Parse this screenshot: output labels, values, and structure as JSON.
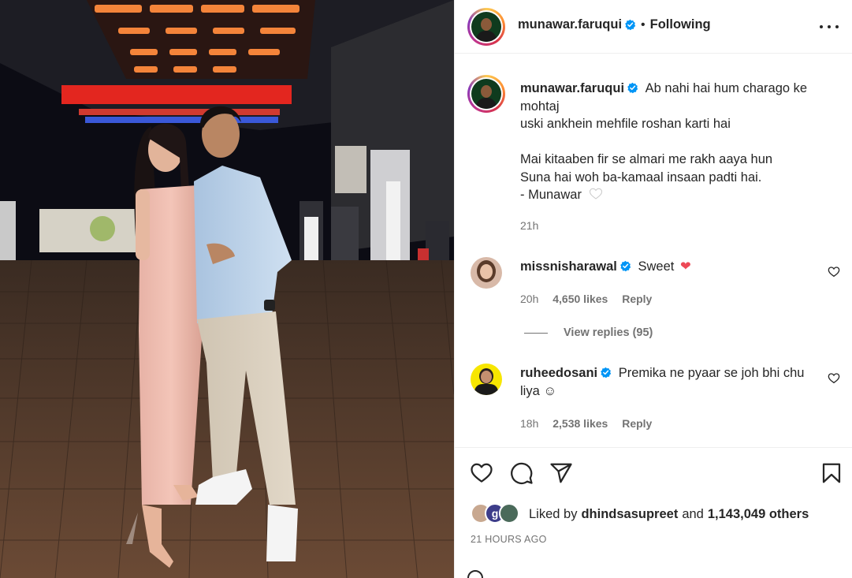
{
  "post": {
    "author": "munawar.faruqui",
    "follow_separator": "•",
    "follow_status": "Following",
    "more_icon": "more-horizontal-icon"
  },
  "caption": {
    "username": "munawar.faruqui",
    "lines": [
      "Ab nahi hai hum charago ke",
      "mohtaj",
      "uski ankhein mehfile roshan karti hai",
      "",
      "Mai kitaaben fir se almari me rakh aaya hun",
      "Suna hai woh ba-kamaal insaan padti hai.",
      "- Munawar"
    ],
    "time": "21h"
  },
  "comments": [
    {
      "username": "missnisharawal",
      "text": "Sweet",
      "emoji": "❤",
      "time": "20h",
      "likes": "4,650 likes",
      "reply": "Reply",
      "replies_link": "View replies (95)"
    },
    {
      "username": "ruheedosani",
      "text": "Premika ne pyaar se joh bhi chu",
      "text_line2": "liya ☺",
      "time": "18h",
      "likes": "2,538 likes",
      "reply": "Reply"
    }
  ],
  "actions": {
    "icons": [
      "heart-icon",
      "comment-icon",
      "share-icon",
      "bookmark-icon"
    ],
    "liked_prefix": "Liked by",
    "liked_user": "dhindsasupreet",
    "liked_and": "and",
    "liked_others": "1,143,049 others",
    "posted": "21 HOURS AGO"
  },
  "colors": {
    "verified": "#0095f6",
    "heart_red": "#ed4956",
    "muted": "#737373",
    "text": "#262626"
  }
}
